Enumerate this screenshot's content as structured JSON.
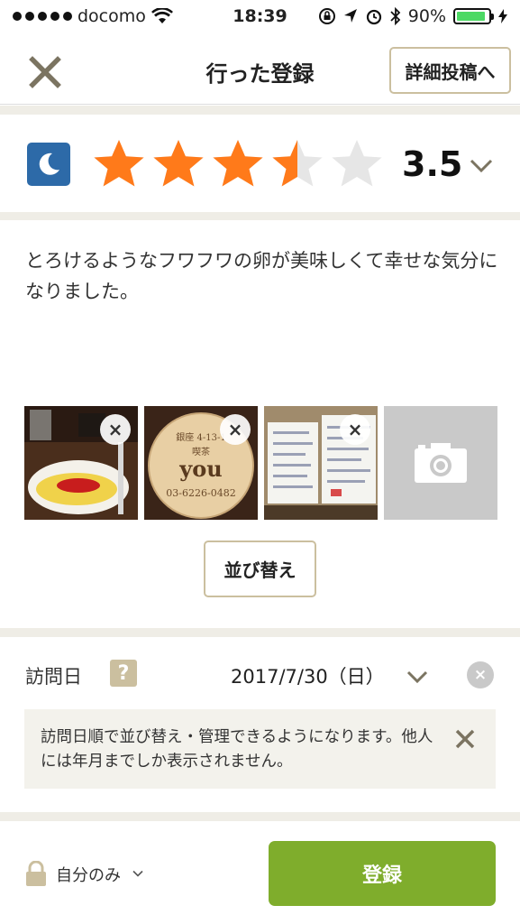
{
  "status_bar": {
    "carrier": "docomo",
    "time": "18:39",
    "battery": "90%",
    "battery_level": 0.9
  },
  "header": {
    "title": "行った登録",
    "detail_button": "詳細投稿へ"
  },
  "rating": {
    "time_icon": "moon-icon",
    "value": "3.5",
    "stars": 3.5,
    "max_stars": 5,
    "star_color": "#ff7a1a",
    "empty_star_color": "#e6e6e6"
  },
  "comment": "とろけるようなフワフワの卵が美味しくて幸せな気分になりました。",
  "photos": {
    "items": [
      {
        "desc": "omelette-photo"
      },
      {
        "desc": "store-sign-photo",
        "sign_lines": [
          "銀座 4-13-1",
          "喫茶",
          "you",
          "03-6226-0482"
        ]
      },
      {
        "desc": "menu-board-photo"
      }
    ],
    "remove_glyph": "×",
    "add_icon": "camera-icon",
    "sort_button": "並び替え"
  },
  "visit": {
    "label": "訪問日",
    "help_glyph": "?",
    "date": "2017/7/30（日）",
    "clear_glyph": "×",
    "notice": "訪問日順で並び替え・管理できるようになります。他人には年月までしか表示されません。"
  },
  "footer": {
    "privacy": "自分のみ",
    "submit": "登録",
    "submit_color": "#7fad2c"
  }
}
